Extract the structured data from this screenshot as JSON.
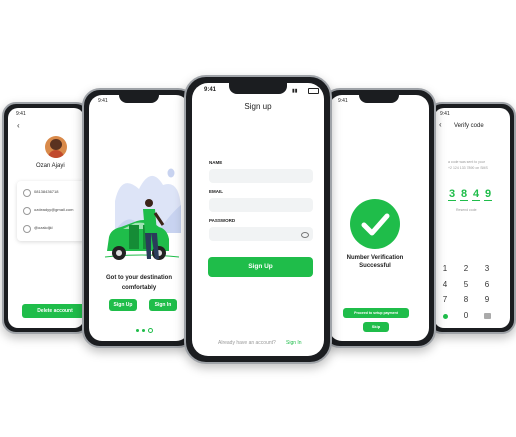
{
  "status_time": "9:41",
  "colors": {
    "accent": "#1fbd4a",
    "frame": "#1b1d20",
    "field": "#f1f3f4"
  },
  "profile": {
    "name": "Ozan Ajayi",
    "phone": "08138436718",
    "email": "ozdeadyy@gmail.com",
    "handle": "@ozakdjkl",
    "delete_label": "Delete account"
  },
  "onboarding": {
    "headline_line1": "Got to your destination",
    "headline_line2": "comfortably",
    "signup_label": "Sign Up",
    "signin_label": "Sign In"
  },
  "signup": {
    "title": "Sign up",
    "name_label": "NAME",
    "email_label": "EMAIL",
    "password_label": "PASSWORD",
    "submit_label": "Sign Up",
    "footer_text": "Already have an account?",
    "footer_link": "Sign In"
  },
  "success": {
    "line1": "Number Verification",
    "line2": "Successful",
    "proceed_label": "Proceed to setup payment",
    "skip_label": "Skip"
  },
  "verify": {
    "title": "Verify code",
    "hint_line1": "a code was sent to your",
    "hint_line2": "+2 124 133 7890 on SMS",
    "digits": [
      "3",
      "8",
      "4",
      "9"
    ],
    "resend": "Resend code",
    "keys": [
      "1",
      "2",
      "3",
      "4",
      "5",
      "6",
      "7",
      "8",
      "9",
      "0"
    ]
  }
}
